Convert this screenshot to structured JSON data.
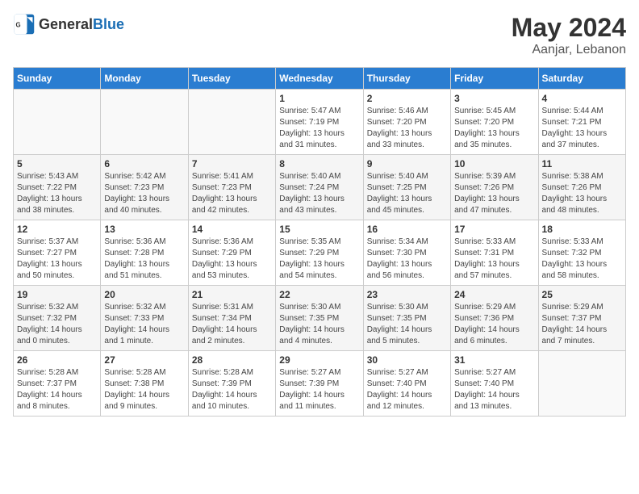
{
  "header": {
    "logo_general": "General",
    "logo_blue": "Blue",
    "title": "May 2024",
    "location": "Aanjar, Lebanon"
  },
  "days_of_week": [
    "Sunday",
    "Monday",
    "Tuesday",
    "Wednesday",
    "Thursday",
    "Friday",
    "Saturday"
  ],
  "weeks": [
    [
      {
        "date": "",
        "info": ""
      },
      {
        "date": "",
        "info": ""
      },
      {
        "date": "",
        "info": ""
      },
      {
        "date": "1",
        "info": "Sunrise: 5:47 AM\nSunset: 7:19 PM\nDaylight: 13 hours and 31 minutes."
      },
      {
        "date": "2",
        "info": "Sunrise: 5:46 AM\nSunset: 7:20 PM\nDaylight: 13 hours and 33 minutes."
      },
      {
        "date": "3",
        "info": "Sunrise: 5:45 AM\nSunset: 7:20 PM\nDaylight: 13 hours and 35 minutes."
      },
      {
        "date": "4",
        "info": "Sunrise: 5:44 AM\nSunset: 7:21 PM\nDaylight: 13 hours and 37 minutes."
      }
    ],
    [
      {
        "date": "5",
        "info": "Sunrise: 5:43 AM\nSunset: 7:22 PM\nDaylight: 13 hours and 38 minutes."
      },
      {
        "date": "6",
        "info": "Sunrise: 5:42 AM\nSunset: 7:23 PM\nDaylight: 13 hours and 40 minutes."
      },
      {
        "date": "7",
        "info": "Sunrise: 5:41 AM\nSunset: 7:23 PM\nDaylight: 13 hours and 42 minutes."
      },
      {
        "date": "8",
        "info": "Sunrise: 5:40 AM\nSunset: 7:24 PM\nDaylight: 13 hours and 43 minutes."
      },
      {
        "date": "9",
        "info": "Sunrise: 5:40 AM\nSunset: 7:25 PM\nDaylight: 13 hours and 45 minutes."
      },
      {
        "date": "10",
        "info": "Sunrise: 5:39 AM\nSunset: 7:26 PM\nDaylight: 13 hours and 47 minutes."
      },
      {
        "date": "11",
        "info": "Sunrise: 5:38 AM\nSunset: 7:26 PM\nDaylight: 13 hours and 48 minutes."
      }
    ],
    [
      {
        "date": "12",
        "info": "Sunrise: 5:37 AM\nSunset: 7:27 PM\nDaylight: 13 hours and 50 minutes."
      },
      {
        "date": "13",
        "info": "Sunrise: 5:36 AM\nSunset: 7:28 PM\nDaylight: 13 hours and 51 minutes."
      },
      {
        "date": "14",
        "info": "Sunrise: 5:36 AM\nSunset: 7:29 PM\nDaylight: 13 hours and 53 minutes."
      },
      {
        "date": "15",
        "info": "Sunrise: 5:35 AM\nSunset: 7:29 PM\nDaylight: 13 hours and 54 minutes."
      },
      {
        "date": "16",
        "info": "Sunrise: 5:34 AM\nSunset: 7:30 PM\nDaylight: 13 hours and 56 minutes."
      },
      {
        "date": "17",
        "info": "Sunrise: 5:33 AM\nSunset: 7:31 PM\nDaylight: 13 hours and 57 minutes."
      },
      {
        "date": "18",
        "info": "Sunrise: 5:33 AM\nSunset: 7:32 PM\nDaylight: 13 hours and 58 minutes."
      }
    ],
    [
      {
        "date": "19",
        "info": "Sunrise: 5:32 AM\nSunset: 7:32 PM\nDaylight: 14 hours and 0 minutes."
      },
      {
        "date": "20",
        "info": "Sunrise: 5:32 AM\nSunset: 7:33 PM\nDaylight: 14 hours and 1 minute."
      },
      {
        "date": "21",
        "info": "Sunrise: 5:31 AM\nSunset: 7:34 PM\nDaylight: 14 hours and 2 minutes."
      },
      {
        "date": "22",
        "info": "Sunrise: 5:30 AM\nSunset: 7:35 PM\nDaylight: 14 hours and 4 minutes."
      },
      {
        "date": "23",
        "info": "Sunrise: 5:30 AM\nSunset: 7:35 PM\nDaylight: 14 hours and 5 minutes."
      },
      {
        "date": "24",
        "info": "Sunrise: 5:29 AM\nSunset: 7:36 PM\nDaylight: 14 hours and 6 minutes."
      },
      {
        "date": "25",
        "info": "Sunrise: 5:29 AM\nSunset: 7:37 PM\nDaylight: 14 hours and 7 minutes."
      }
    ],
    [
      {
        "date": "26",
        "info": "Sunrise: 5:28 AM\nSunset: 7:37 PM\nDaylight: 14 hours and 8 minutes."
      },
      {
        "date": "27",
        "info": "Sunrise: 5:28 AM\nSunset: 7:38 PM\nDaylight: 14 hours and 9 minutes."
      },
      {
        "date": "28",
        "info": "Sunrise: 5:28 AM\nSunset: 7:39 PM\nDaylight: 14 hours and 10 minutes."
      },
      {
        "date": "29",
        "info": "Sunrise: 5:27 AM\nSunset: 7:39 PM\nDaylight: 14 hours and 11 minutes."
      },
      {
        "date": "30",
        "info": "Sunrise: 5:27 AM\nSunset: 7:40 PM\nDaylight: 14 hours and 12 minutes."
      },
      {
        "date": "31",
        "info": "Sunrise: 5:27 AM\nSunset: 7:40 PM\nDaylight: 14 hours and 13 minutes."
      },
      {
        "date": "",
        "info": ""
      }
    ]
  ]
}
